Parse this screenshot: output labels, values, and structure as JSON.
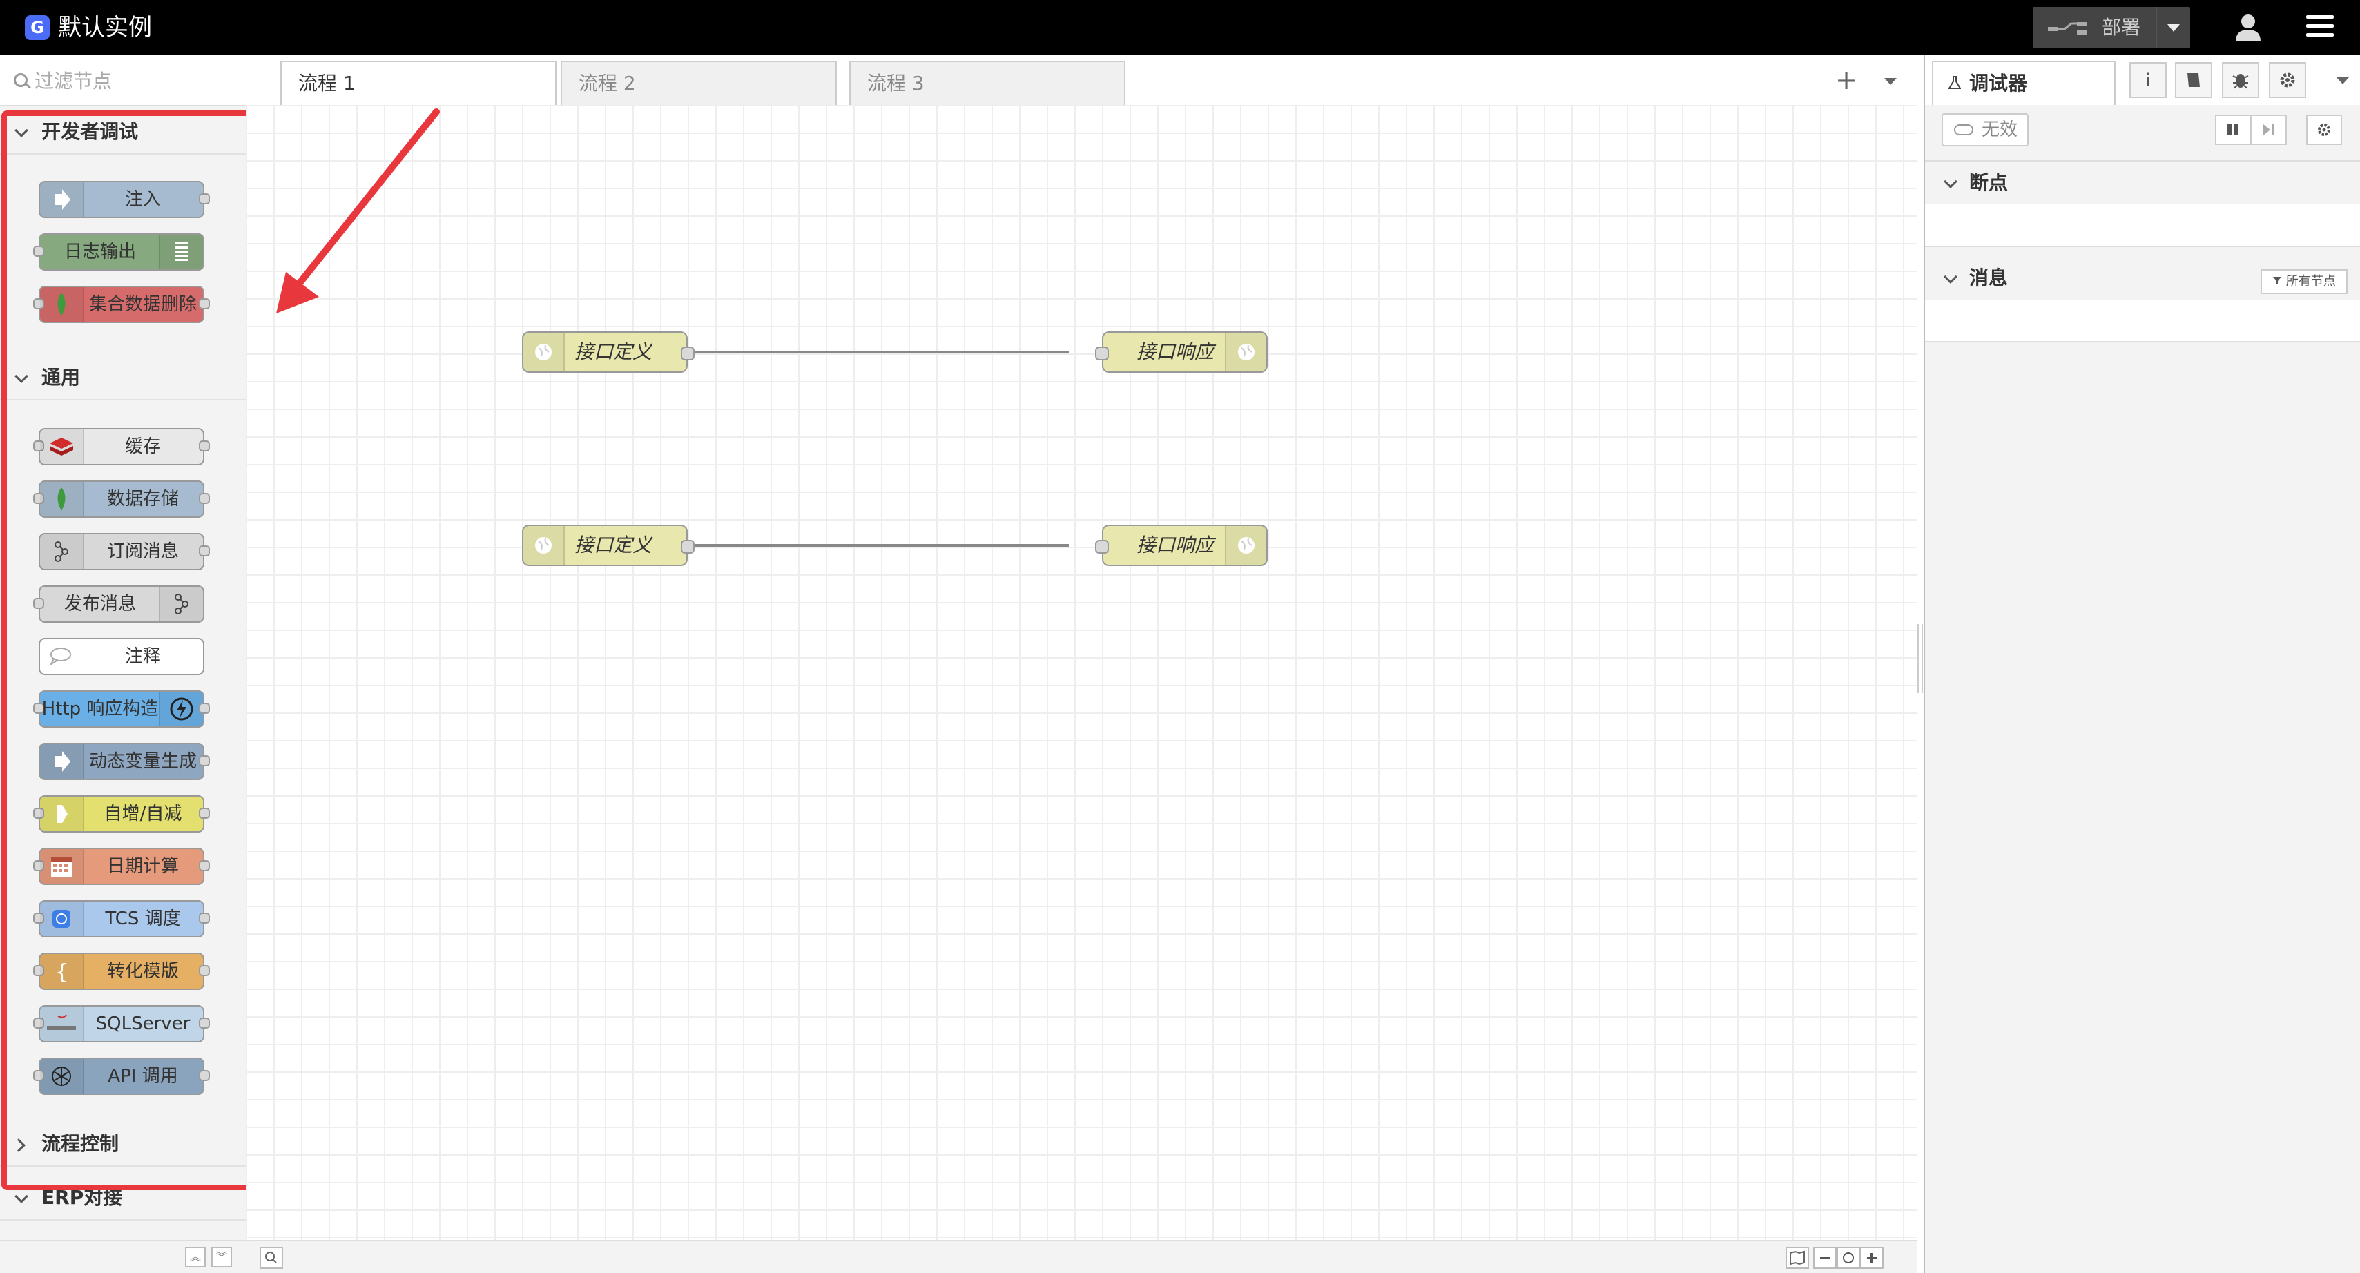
{
  "app": {
    "title": "默认实例",
    "logo_letter": "G"
  },
  "header": {
    "deploy_label": "部署"
  },
  "palette": {
    "filter_placeholder": "过滤节点",
    "categories": [
      {
        "label": "开发者调试",
        "expanded": true,
        "nodes": [
          {
            "label": "注入",
            "color": "#a6bbcf",
            "icon": "inject-arrow-icon"
          },
          {
            "label": "日志输出",
            "color": "#87a980",
            "icon": "list-icon"
          },
          {
            "label": "集合数据删除",
            "color": "#d66b6b",
            "icon": "mongodb-leaf-icon"
          }
        ]
      },
      {
        "label": "通用",
        "expanded": true,
        "nodes": [
          {
            "label": "缓存",
            "color": "#e8e8e8",
            "icon": "redis-icon"
          },
          {
            "label": "数据存储",
            "color": "#a6bbcf",
            "icon": "mongodb-leaf-icon"
          },
          {
            "label": "订阅消息",
            "color": "#d8d8d8",
            "icon": "mqtt-icon"
          },
          {
            "label": "发布消息",
            "color": "#d8d8d8",
            "icon": "mqtt-icon"
          },
          {
            "label": "注释",
            "color": "#ffffff",
            "icon": "comment-icon"
          },
          {
            "label": "Http 响应构造",
            "color": "#6ab0e6",
            "icon": "lightning-icon"
          },
          {
            "label": "动态变量生成",
            "color": "#8ea6bf",
            "icon": "inject-arrow-icon"
          },
          {
            "label": "自增/自减",
            "color": "#e3e06f",
            "icon": "function-arrow-icon"
          },
          {
            "label": "日期计算",
            "color": "#e69a7c",
            "icon": "calendar-icon"
          },
          {
            "label": "TCS 调度",
            "color": "#a9c8ec",
            "icon": "tcs-icon"
          },
          {
            "label": "转化模版",
            "color": "#e5b063",
            "icon": "brace-icon"
          },
          {
            "label": "SQLServer",
            "color": "#c0d6e8",
            "icon": "sqlserver-icon"
          },
          {
            "label": "API 调用",
            "color": "#8aa4be",
            "icon": "api-icon"
          }
        ]
      },
      {
        "label": "流程控制",
        "expanded": false
      },
      {
        "label": "ERP对接",
        "expanded": true
      }
    ]
  },
  "workspace": {
    "tabs": [
      {
        "label": "流程 1",
        "active": true
      },
      {
        "label": "流程 2",
        "active": false
      },
      {
        "label": "流程 3",
        "active": false
      }
    ],
    "nodes": [
      {
        "label": "接口定义",
        "kind": "http-in",
        "color": "#e7e7ae",
        "icon": "globe-icon"
      },
      {
        "label": "接口响应",
        "kind": "http-response",
        "color": "#e7e7ae",
        "icon": "globe-icon"
      },
      {
        "label": "接口定义",
        "kind": "http-in",
        "color": "#e7e7ae",
        "icon": "globe-icon"
      },
      {
        "label": "接口响应",
        "kind": "http-response",
        "color": "#e7e7ae",
        "icon": "globe-icon"
      }
    ]
  },
  "sidebar": {
    "active_tab": "调试器",
    "disable_label": "无效",
    "sections": [
      {
        "label": "断点"
      },
      {
        "label": "消息",
        "filter_label": "所有节点"
      }
    ]
  },
  "colors": {
    "highlight": "#e8383d",
    "header_bg": "#000000",
    "wire": "#888888"
  }
}
